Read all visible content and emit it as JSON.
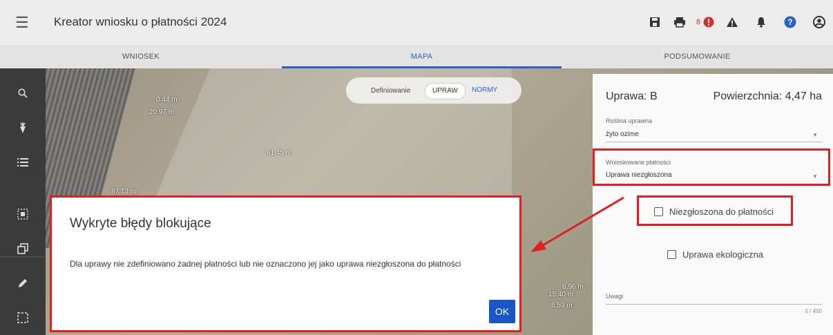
{
  "app": {
    "title": "Kreator wniosku o płatności 2024",
    "alert_count": "8"
  },
  "tabs": [
    {
      "label": "WNIOSEK"
    },
    {
      "label": "MAPA"
    },
    {
      "label": "PODSUMOWANIE"
    }
  ],
  "map": {
    "toggle": {
      "label": "Definiowanie",
      "option1": "UPRAW",
      "option2": "NORMY"
    },
    "labels": [
      "0.44 m",
      "20.97 m",
      "61.45 m",
      "87.13 m",
      "6.96 m",
      "15.40 m",
      "6.59 m"
    ]
  },
  "panel": {
    "title": "Uprawa: B",
    "area": "Powierzchnia: 4,47 ha",
    "plant_label": "Roślina uprawna",
    "plant_value": "żyto ozime",
    "payments_label": "Wnioskowane płatności",
    "payments_value": "Uprawa niezgłoszona",
    "check1": "Niezgłoszona do płatności",
    "check2": "Uprawa ekologiczna",
    "notes_label": "Uwagi",
    "counter": "0 / 450"
  },
  "dialog": {
    "title": "Wykryte błędy blokujące",
    "message": "Dla uprawy nie zdefiniowano żadnej płatności lub nie oznaczono jej jako uprawa niezgłoszona do płatności",
    "ok": "OK"
  },
  "colors": {
    "accent": "#2962c6",
    "highlight": "#e0201f",
    "ok_button": "#1a56c8",
    "error": "#d32f2f"
  },
  "icons": [
    "menu-icon",
    "save-icon",
    "print-icon",
    "error-icon",
    "warning-icon",
    "bell-icon",
    "help-icon",
    "account-icon",
    "search-icon",
    "carrot-icon",
    "list-icon",
    "select-icon",
    "copy-icon",
    "edit-icon",
    "area-select-icon"
  ]
}
